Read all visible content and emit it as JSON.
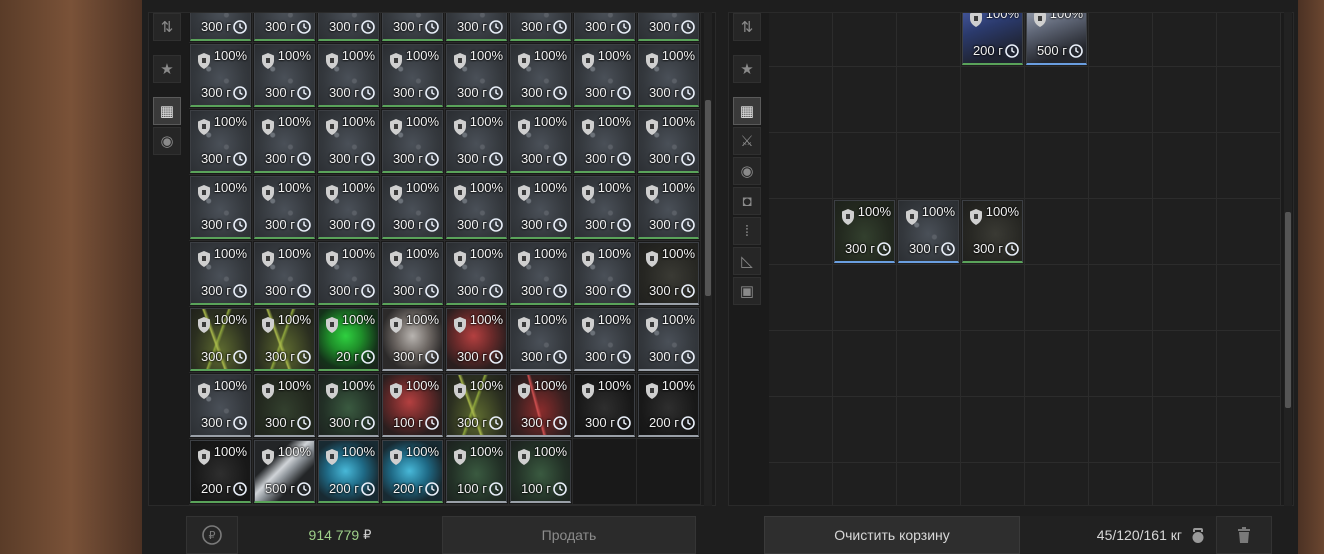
{
  "left_sidebar": [
    {
      "name": "sort-icon",
      "glyph": "⇅",
      "active": false
    },
    {
      "name": "star-icon",
      "glyph": "★",
      "active": false
    },
    {
      "name": "grid-icon",
      "glyph": "▦",
      "active": true
    },
    {
      "name": "artifact-icon",
      "glyph": "◉",
      "active": false
    }
  ],
  "right_sidebar": [
    {
      "name": "sort-icon",
      "glyph": "⇅",
      "active": false
    },
    {
      "name": "star-icon",
      "glyph": "★",
      "active": false
    },
    {
      "name": "grid-icon",
      "glyph": "▦",
      "active": true
    },
    {
      "name": "knife-icon",
      "glyph": "⚔",
      "active": false
    },
    {
      "name": "artifact-icon",
      "glyph": "◉",
      "active": false
    },
    {
      "name": "camera-icon",
      "glyph": "◘",
      "active": false
    },
    {
      "name": "ammo-icon",
      "glyph": "⁞",
      "active": false
    },
    {
      "name": "ruler-icon",
      "glyph": "◺",
      "active": false
    },
    {
      "name": "box-icon",
      "glyph": "▣",
      "active": false
    }
  ],
  "stash_items": [
    {
      "art": "gravel",
      "pct": "100%",
      "price": "300 г",
      "border": "green"
    },
    {
      "art": "gravel",
      "pct": "100%",
      "price": "300 г",
      "border": "green"
    },
    {
      "art": "gravel",
      "pct": "100%",
      "price": "300 г",
      "border": "green"
    },
    {
      "art": "gravel",
      "pct": "100%",
      "price": "300 г",
      "border": "green"
    },
    {
      "art": "gravel",
      "pct": "100%",
      "price": "300 г",
      "border": "green"
    },
    {
      "art": "gravel",
      "pct": "100%",
      "price": "300 г",
      "border": "green"
    },
    {
      "art": "gravel",
      "pct": "100%",
      "price": "300 г",
      "border": "green"
    },
    {
      "art": "gravel",
      "pct": "100%",
      "price": "300 г",
      "border": "green"
    },
    {
      "art": "gravel",
      "pct": "100%",
      "price": "300 г",
      "border": "green"
    },
    {
      "art": "gravel",
      "pct": "100%",
      "price": "300 г",
      "border": "green"
    },
    {
      "art": "gravel",
      "pct": "100%",
      "price": "300 г",
      "border": "green"
    },
    {
      "art": "gravel",
      "pct": "100%",
      "price": "300 г",
      "border": "green"
    },
    {
      "art": "gravel",
      "pct": "100%",
      "price": "300 г",
      "border": "green"
    },
    {
      "art": "gravel",
      "pct": "100%",
      "price": "300 г",
      "border": "green"
    },
    {
      "art": "gravel",
      "pct": "100%",
      "price": "300 г",
      "border": "green"
    },
    {
      "art": "gravel",
      "pct": "100%",
      "price": "300 г",
      "border": "green"
    },
    {
      "art": "gravel",
      "pct": "100%",
      "price": "300 г",
      "border": "green"
    },
    {
      "art": "gravel",
      "pct": "100%",
      "price": "300 г",
      "border": "green"
    },
    {
      "art": "gravel",
      "pct": "100%",
      "price": "300 г",
      "border": "green"
    },
    {
      "art": "gravel",
      "pct": "100%",
      "price": "300 г",
      "border": "green"
    },
    {
      "art": "gravel",
      "pct": "100%",
      "price": "300 г",
      "border": "green"
    },
    {
      "art": "gravel",
      "pct": "100%",
      "price": "300 г",
      "border": "green"
    },
    {
      "art": "gravel",
      "pct": "100%",
      "price": "300 г",
      "border": "green"
    },
    {
      "art": "gravel",
      "pct": "100%",
      "price": "300 г",
      "border": "green"
    },
    {
      "art": "gravel",
      "pct": "100%",
      "price": "300 г",
      "border": "green"
    },
    {
      "art": "gravel",
      "pct": "100%",
      "price": "300 г",
      "border": "green"
    },
    {
      "art": "gravel",
      "pct": "100%",
      "price": "300 г",
      "border": "green"
    },
    {
      "art": "gravel",
      "pct": "100%",
      "price": "300 г",
      "border": "green"
    },
    {
      "art": "gravel",
      "pct": "100%",
      "price": "300 г",
      "border": "green"
    },
    {
      "art": "gravel",
      "pct": "100%",
      "price": "300 г",
      "border": "green"
    },
    {
      "art": "gravel",
      "pct": "100%",
      "price": "300 г",
      "border": "green"
    },
    {
      "art": "gravel",
      "pct": "100%",
      "price": "300 г",
      "border": "green"
    },
    {
      "art": "gravel",
      "pct": "100%",
      "price": "300 г",
      "border": "green"
    },
    {
      "art": "gravel",
      "pct": "100%",
      "price": "300 г",
      "border": "green"
    },
    {
      "art": "gravel",
      "pct": "100%",
      "price": "300 г",
      "border": "green"
    },
    {
      "art": "gravel",
      "pct": "100%",
      "price": "300 г",
      "border": "green"
    },
    {
      "art": "gravel",
      "pct": "100%",
      "price": "300 г",
      "border": "green"
    },
    {
      "art": "gravel",
      "pct": "100%",
      "price": "300 г",
      "border": "green"
    },
    {
      "art": "gravel",
      "pct": "100%",
      "price": "300 г",
      "border": "green"
    },
    {
      "art": "dark",
      "pct": "100%",
      "price": "300 г",
      "border": "gray"
    },
    {
      "art": "yellowplant",
      "pct": "100%",
      "price": "300 г",
      "border": "green"
    },
    {
      "art": "yellowplant",
      "pct": "100%",
      "price": "300 г",
      "border": "green"
    },
    {
      "art": "greencrystal",
      "pct": "100%",
      "price": "20 г",
      "border": "green"
    },
    {
      "art": "whiteorg",
      "pct": "100%",
      "price": "300 г",
      "border": "gray"
    },
    {
      "art": "redorg",
      "pct": "100%",
      "price": "300 г",
      "border": "gray"
    },
    {
      "art": "gravel",
      "pct": "100%",
      "price": "300 г",
      "border": "gray"
    },
    {
      "art": "gravel",
      "pct": "100%",
      "price": "300 г",
      "border": "gray"
    },
    {
      "art": "gravel",
      "pct": "100%",
      "price": "300 г",
      "border": "gray"
    },
    {
      "art": "gravel",
      "pct": "100%",
      "price": "300 г",
      "border": "gray"
    },
    {
      "art": "moss",
      "pct": "100%",
      "price": "300 г",
      "border": "gray"
    },
    {
      "art": "greenstone",
      "pct": "100%",
      "price": "300 г",
      "border": "gray"
    },
    {
      "art": "redorg",
      "pct": "100%",
      "price": "100 г",
      "border": "gray"
    },
    {
      "art": "yellowplant",
      "pct": "100%",
      "price": "300 г",
      "border": "gray"
    },
    {
      "art": "redplant",
      "pct": "100%",
      "price": "300 г",
      "border": "gray"
    },
    {
      "art": "blackstone",
      "pct": "100%",
      "price": "300 г",
      "border": "gray"
    },
    {
      "art": "blackstone",
      "pct": "100%",
      "price": "200 г",
      "border": "gray"
    },
    {
      "art": "blackstone",
      "pct": "100%",
      "price": "200 г",
      "border": "green"
    },
    {
      "art": "whitecrystal",
      "pct": "100%",
      "price": "500 г",
      "border": "green"
    },
    {
      "art": "bluecrystal",
      "pct": "100%",
      "price": "200 г",
      "border": "green"
    },
    {
      "art": "bluecrystal",
      "pct": "100%",
      "price": "200 г",
      "border": "green"
    },
    {
      "art": "greenstone",
      "pct": "100%",
      "price": "100 г",
      "border": "gray"
    },
    {
      "art": "greenstone",
      "pct": "100%",
      "price": "100 г",
      "border": "gray"
    }
  ],
  "cart_items": [
    {
      "row": 0,
      "col": 3,
      "art": "bluetop",
      "pct": "100%",
      "price": "200 г",
      "border": "green"
    },
    {
      "row": 0,
      "col": 4,
      "art": "graytop",
      "pct": "100%",
      "price": "500 г",
      "border": "blue"
    },
    {
      "row": 3,
      "col": 1,
      "art": "moss",
      "pct": "100%",
      "price": "300 г",
      "border": "blue"
    },
    {
      "row": 3,
      "col": 2,
      "art": "gravel",
      "pct": "100%",
      "price": "300 г",
      "border": "blue"
    },
    {
      "row": 3,
      "col": 3,
      "art": "dark",
      "pct": "100%",
      "price": "300 г",
      "border": "green"
    }
  ],
  "bottom_bar": {
    "money": "914 779",
    "currency": "₽",
    "sell_label": "Продать",
    "clear_label": "Очистить корзину",
    "weight": "45/120/161 кг"
  }
}
